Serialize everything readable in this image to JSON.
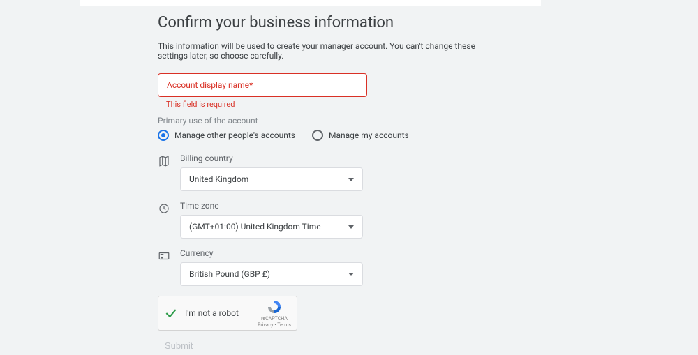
{
  "heading": "Confirm your business information",
  "hint": "This information will be used to create your manager account. You can't change these settings later, so choose carefully.",
  "account_name": {
    "placeholder": "Account display name",
    "asterisk": "*",
    "error": "This field is required"
  },
  "primary_use": {
    "label": "Primary use of the account",
    "option_others": "Manage other people's accounts",
    "option_mine": "Manage my accounts",
    "selected": "others"
  },
  "billing": {
    "label": "Billing country",
    "value": "United Kingdom"
  },
  "timezone": {
    "label": "Time zone",
    "value": "(GMT+01:00) United Kingdom Time"
  },
  "currency": {
    "label": "Currency",
    "value": "British Pound (GBP £)"
  },
  "recaptcha": {
    "label": "I'm not a robot",
    "brand": "reCAPTCHA",
    "links": "Privacy  •  Terms"
  },
  "submit": "Submit"
}
